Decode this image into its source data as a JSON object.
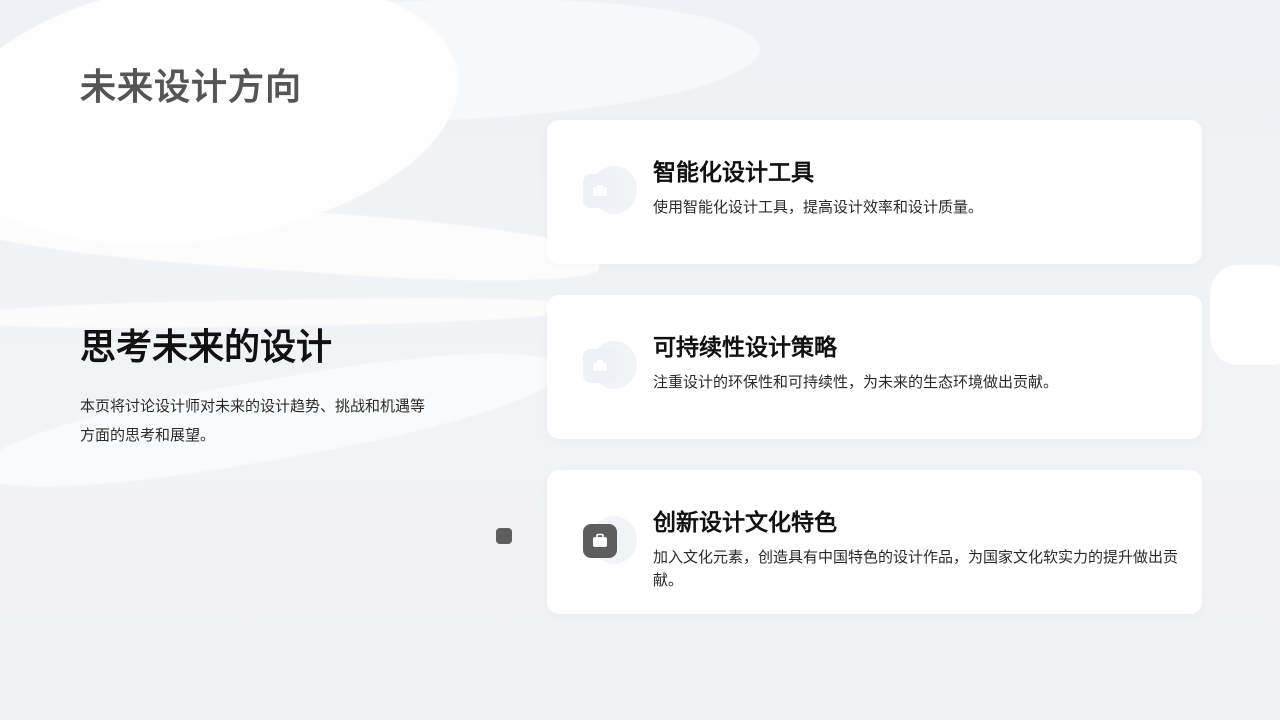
{
  "slide": {
    "title": "未来设计方向"
  },
  "left": {
    "heading": "思考未来的设计",
    "description": "本页将讨论设计师对未来的设计趋势、挑战和机遇等方面的思考和展望。"
  },
  "cards": [
    {
      "title": "智能化设计工具",
      "description": "使用智能化设计工具，提高设计效率和设计质量。",
      "icon": "tool-icon"
    },
    {
      "title": "可持续性设计策略",
      "description": "注重设计的环保性和可持续性，为未来的生态环境做出贡献。",
      "icon": "leaf-icon"
    },
    {
      "title": "创新设计文化特色",
      "description": "加入文化元素，创造具有中国特色的设计作品，为国家文化软实力的提升做出贡献。",
      "icon": "briefcase-icon"
    }
  ],
  "colors": {
    "background": "#eef0f4",
    "card": "#ffffff",
    "accent": "#5e5e5e",
    "title_gray": "#555555",
    "text_dark": "#111111"
  }
}
